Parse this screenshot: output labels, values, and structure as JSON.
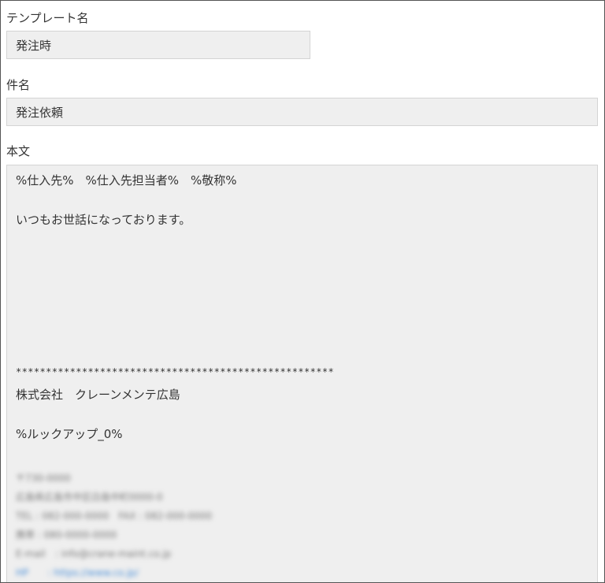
{
  "template_name": {
    "label": "テンプレート名",
    "value": "発注時"
  },
  "subject": {
    "label": "件名",
    "value": "発注依頼"
  },
  "body": {
    "label": "本文",
    "lines": {
      "addressee": "%仕入先%　%仕入先担当者%　%敬称%",
      "greeting": "いつもお世話になっております。",
      "separator": "*****************************************************",
      "company": "株式会社　クレーンメンテ広島",
      "lookup": "%ルックアップ_0%"
    },
    "redacted_signature": [
      "〒730-0000",
      "広島県広島市中区白島中町0000-0",
      "TEL : 082-000-0000　FAX : 082-000-0000",
      "携帯 : 080-0000-0000",
      "E-mail　: info@crane-maint.co.jp",
      "HP　　: https://www.co.jp/"
    ]
  }
}
